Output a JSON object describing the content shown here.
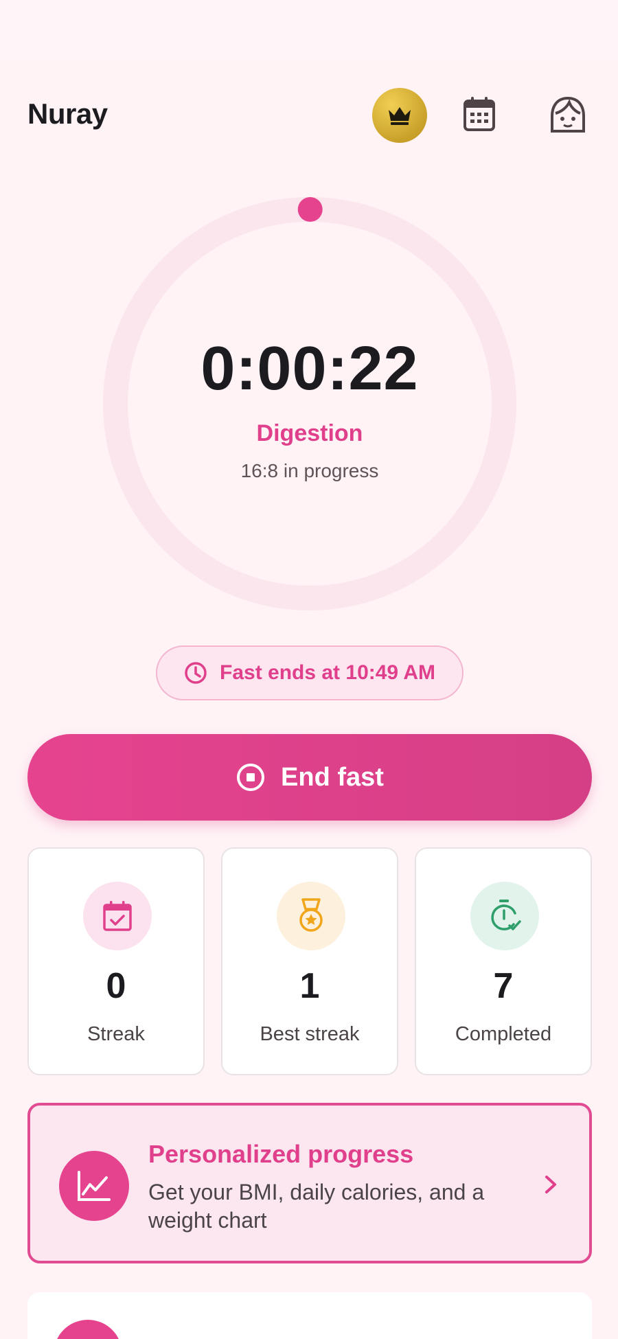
{
  "header": {
    "title": "Nuray",
    "premium_icon": "crown-icon",
    "calendar_icon": "calendar-icon",
    "profile_icon": "face-avatar-icon"
  },
  "timer": {
    "elapsed": "0:00:22",
    "phase": "Digestion",
    "plan_status": "16:8 in progress",
    "progress_fraction": 0.0004
  },
  "fast_end": {
    "icon": "clock-icon",
    "label": "Fast ends at 10:49 AM"
  },
  "end_button": {
    "icon": "stop-circle-icon",
    "label": "End fast"
  },
  "stats": [
    {
      "icon": "calendar-check-icon",
      "value": "0",
      "label": "Streak"
    },
    {
      "icon": "medal-icon",
      "value": "1",
      "label": "Best streak"
    },
    {
      "icon": "stopwatch-check-icon",
      "value": "7",
      "label": "Completed"
    }
  ],
  "promo": {
    "icon": "trend-chart-icon",
    "title": "Personalized progress",
    "body": "Get your BMI, daily calories, and a weight chart",
    "chevron_icon": "chevron-right-icon"
  },
  "colors": {
    "accent": "#e03f8c",
    "background": "#fff3f6",
    "gold": "#d4ac33",
    "medal_orange": "#f0a51a",
    "green": "#2e9e6b"
  }
}
